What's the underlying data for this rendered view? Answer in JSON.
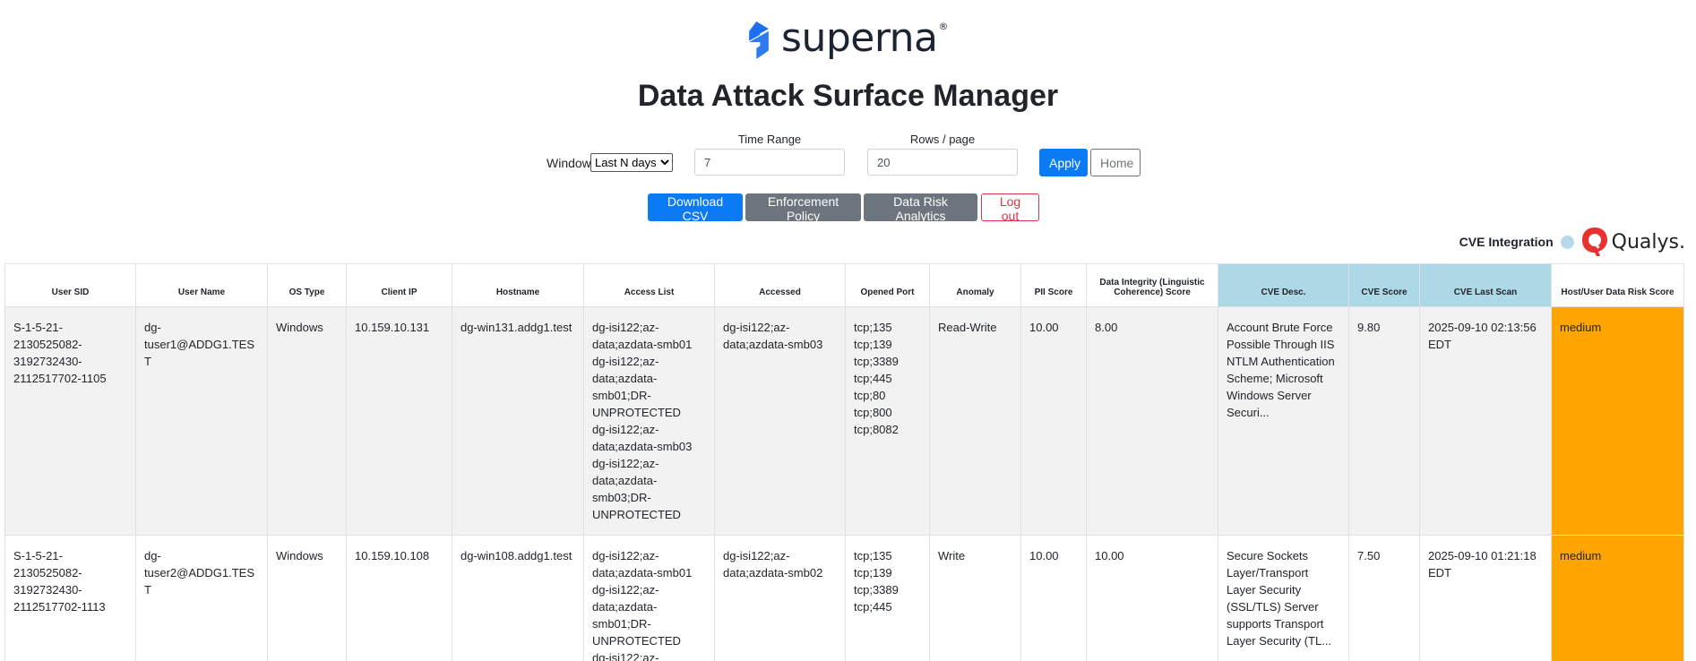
{
  "brand": {
    "logo_text": "superna",
    "logo_reg": "®",
    "color": "#1e6ff0"
  },
  "page_title": "Data Attack Surface Manager",
  "filters": {
    "window_label": "Window",
    "window_selected": "Last N days",
    "time_range_label": "Time Range",
    "time_range_value": "7",
    "rows_label": "Rows / page",
    "rows_value": "20",
    "apply_label": "Apply",
    "home_label": "Home"
  },
  "actions": {
    "download_csv": "Download CSV",
    "enforcement_policy": "Enforcement Policy",
    "data_risk_analytics": "Data Risk Analytics",
    "log_out": "Log out"
  },
  "cve_integration": {
    "label": "CVE Integration",
    "partner": "Qualys.",
    "partner_color": "#e8322f"
  },
  "table": {
    "headers": [
      "User SID",
      "User Name",
      "OS Type",
      "Client IP",
      "Hostname",
      "Access List",
      "Accessed",
      "Opened Port",
      "Anomaly",
      "PII Score",
      "Data Integrity (Linguistic Coherence) Score",
      "CVE Desc.",
      "CVE Score",
      "CVE Last Scan",
      "Host/User Data Risk Score"
    ],
    "rows": [
      {
        "user_sid": "S-1-5-21-2130525082-3192732430-2112517702-1105",
        "user_name": "dg-tuser1@ADDG1.TEST",
        "os_type": "Windows",
        "client_ip": "10.159.10.131",
        "hostname": "dg-win131.addg1.test",
        "access_list": [
          "dg-isi122;az-data;azdata-smb01",
          "dg-isi122;az-data;azdata-smb01;DR-UNPROTECTED",
          "dg-isi122;az-data;azdata-smb03",
          "dg-isi122;az-data;azdata-smb03;DR-UNPROTECTED"
        ],
        "accessed": "dg-isi122;az-data;azdata-smb03",
        "opened_port": [
          "tcp;135",
          "tcp;139",
          "tcp;3389",
          "tcp;445",
          "tcp;80",
          "tcp;800",
          "tcp;8082"
        ],
        "anomaly": "Read-Write",
        "pii_score": "10.00",
        "integrity_score": "8.00",
        "cve_desc": "Account Brute Force Possible Through IIS NTLM Authentication Scheme; Microsoft Windows Server Securi...",
        "cve_score": "9.80",
        "cve_last_scan": "2025-09-10 02:13:56 EDT",
        "risk": "medium"
      },
      {
        "user_sid": "S-1-5-21-2130525082-3192732430-2112517702-1113",
        "user_name": "dg-tuser2@ADDG1.TEST",
        "os_type": "Windows",
        "client_ip": "10.159.10.108",
        "hostname": "dg-win108.addg1.test",
        "access_list": [
          "dg-isi122;az-data;azdata-smb01",
          "dg-isi122;az-data;azdata-smb01;DR-UNPROTECTED",
          "dg-isi122;az-"
        ],
        "accessed": "dg-isi122;az-data;azdata-smb02",
        "opened_port": [
          "tcp;135",
          "tcp;139",
          "tcp;3389",
          "tcp;445"
        ],
        "anomaly": "Write",
        "pii_score": "10.00",
        "integrity_score": "10.00",
        "cve_desc": "Secure Sockets Layer/Transport Layer Security (SSL/TLS) Server supports Transport Layer Security (TL...",
        "cve_score": "7.50",
        "cve_last_scan": "2025-09-10 01:21:18 EDT",
        "risk": "medium"
      }
    ]
  }
}
